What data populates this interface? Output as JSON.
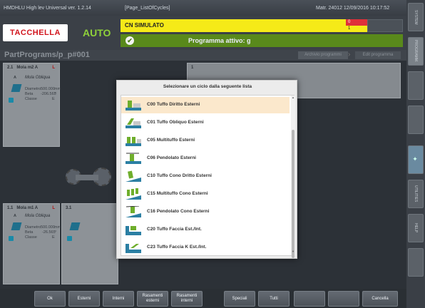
{
  "titlebar": {
    "app": "HMDHLU High lev Universal  ver. 1.2.14",
    "page": "[Page_ListOfCycles]",
    "status": "Matr. 24012  12/09/2016 10:17:52"
  },
  "header": {
    "brand": "TACCHELLA",
    "mode": "AUTO",
    "cn_message": "CN SIMULATO",
    "alarm_top": "0",
    "alarm_bottom": "1",
    "program_active": "Programma attivo: g"
  },
  "breadcrumb": {
    "path": "PartPrograms/p_p#001",
    "nav_prev": "Archivio programmi",
    "nav_next": "Edit programma"
  },
  "panels": [
    {
      "num": "2.1",
      "title": "Mola m2 A",
      "flag": "L",
      "letter": "A",
      "subtitle": "Mola Obliqua",
      "rows": [
        [
          "Diametro",
          "500.000",
          "mm"
        ],
        [
          "Beta",
          "-206.565",
          "°"
        ],
        [
          "Classe",
          "E",
          ""
        ]
      ]
    },
    {
      "num": "1.1",
      "title": "Mola m1 A",
      "flag": "L",
      "letter": "A",
      "subtitle": "Mola Obliqua",
      "rows": [
        [
          "Diametro",
          "500.000",
          "mm"
        ],
        [
          "Beta",
          "-26.565",
          "°"
        ],
        [
          "Classe",
          "E",
          ""
        ]
      ]
    },
    {
      "num": "3.1",
      "title": ""
    },
    {
      "num": "1",
      "title": ""
    }
  ],
  "modal": {
    "title": "Selezionare un ciclo dalla seguente lista",
    "items": [
      {
        "code": "C00",
        "label": "C00  Tuffo Diritto Esterni",
        "selected": true
      },
      {
        "code": "C01",
        "label": "C01  Tuffo Obliquo Esterni",
        "selected": false
      },
      {
        "code": "C05",
        "label": "C05  Multituffo Esterni",
        "selected": false
      },
      {
        "code": "C06",
        "label": "C06  Pendolato Esterni",
        "selected": false
      },
      {
        "code": "C10",
        "label": "C10  Tuffo Cono Dritto Esterni",
        "selected": false
      },
      {
        "code": "C15",
        "label": "C15  Multituffo Cono Esterni",
        "selected": false
      },
      {
        "code": "C16",
        "label": "C16  Pendolato Cono Esterni",
        "selected": false
      },
      {
        "code": "C20",
        "label": "C20  Tuffo Faccia Est./Int.",
        "selected": false
      },
      {
        "code": "C23",
        "label": "C23  Tuffo Faccia K Est./Int.",
        "selected": false
      }
    ]
  },
  "bottom_buttons": [
    {
      "label": "Ok"
    },
    {
      "label": "Esterni"
    },
    {
      "label": "Interni"
    },
    {
      "label": "Rasamenti esterni"
    },
    {
      "label": "Rasamenti interni"
    },
    {
      "label": "Speciali"
    },
    {
      "label": "Tutti"
    },
    {
      "label": ""
    },
    {
      "label": ""
    },
    {
      "label": ""
    },
    {
      "label": "Cancella"
    }
  ],
  "side_tabs": [
    {
      "label": "SYSTEM"
    },
    {
      "label": "PROGRAMM."
    },
    {
      "label": ""
    },
    {
      "label": ""
    },
    {
      "label": ""
    },
    {
      "label": "UTILITIES"
    },
    {
      "label": "HELP"
    },
    {
      "label": ""
    }
  ],
  "colors": {
    "brand_red": "#d2161e",
    "auto_green": "#8fd13a",
    "cn_yellow": "#f5ea18",
    "status_green": "#59891b",
    "selected_row": "#fbe8cc"
  }
}
